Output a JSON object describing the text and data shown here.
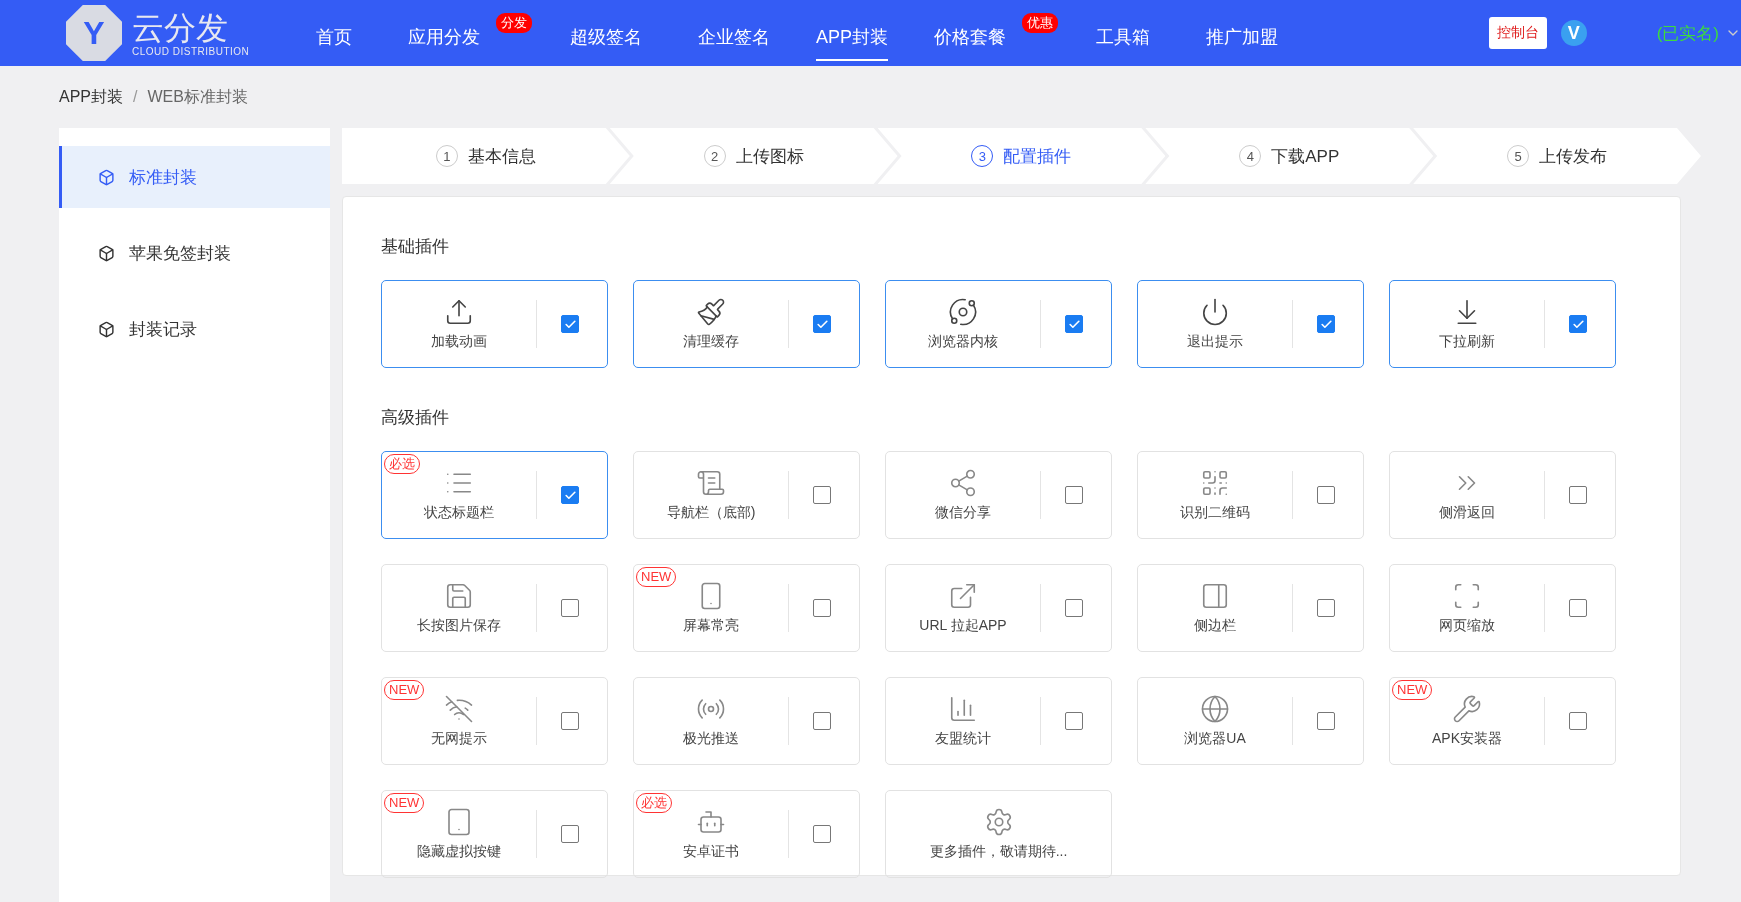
{
  "header": {
    "logo_letter": "Y",
    "logo_title": "云分发",
    "logo_subtitle": "CLOUD DISTRIBUTION",
    "nav": [
      {
        "label": "首页",
        "selected": false
      },
      {
        "label": "应用分发",
        "selected": false,
        "badge": "分发"
      },
      {
        "label": "超级签名",
        "selected": false
      },
      {
        "label": "企业签名",
        "selected": false
      },
      {
        "label": "APP封装",
        "selected": true
      },
      {
        "label": "价格套餐",
        "selected": false,
        "badge": "优惠"
      },
      {
        "label": "工具箱",
        "selected": false
      },
      {
        "label": "推广加盟",
        "selected": false
      }
    ],
    "console_button": "控制台",
    "vip_letter": "V",
    "user_status": "(已实名)"
  },
  "breadcrumb": {
    "items": [
      "APP封装",
      "WEB标准封装"
    ],
    "separator": "/"
  },
  "sidebar": {
    "items": [
      {
        "label": "标准封装",
        "selected": true
      },
      {
        "label": "苹果免签封装",
        "selected": false
      },
      {
        "label": "封装记录",
        "selected": false
      }
    ]
  },
  "steps": [
    {
      "number": "1",
      "label": "基本信息",
      "selected": false
    },
    {
      "number": "2",
      "label": "上传图标",
      "selected": false
    },
    {
      "number": "3",
      "label": "配置插件",
      "selected": true
    },
    {
      "number": "4",
      "label": "下载APP",
      "selected": false
    },
    {
      "number": "5",
      "label": "上传发布",
      "selected": false
    }
  ],
  "sections": [
    {
      "title": "基础插件",
      "plugins": [
        {
          "kind": "toggle",
          "label": "加载动画",
          "checked": true
        },
        {
          "kind": "toggle",
          "label": "清理缓存",
          "checked": true
        },
        {
          "kind": "toggle",
          "label": "浏览器内核",
          "checked": true
        },
        {
          "kind": "toggle",
          "label": "退出提示",
          "checked": true
        },
        {
          "kind": "toggle",
          "label": "下拉刷新",
          "checked": true
        }
      ]
    },
    {
      "title": "高级插件",
      "plugins": [
        {
          "kind": "toggle",
          "label": "状态标题栏",
          "checked": true,
          "badge": "必选"
        },
        {
          "kind": "toggle",
          "label": "导航栏（底部)",
          "checked": false
        },
        {
          "kind": "toggle",
          "label": "微信分享",
          "checked": false
        },
        {
          "kind": "toggle",
          "label": "识别二维码",
          "checked": false
        },
        {
          "kind": "toggle",
          "label": "侧滑返回",
          "checked": false
        },
        {
          "kind": "toggle",
          "label": "长按图片保存",
          "checked": false
        },
        {
          "kind": "toggle",
          "label": "屏幕常亮",
          "checked": false,
          "badge": "NEW"
        },
        {
          "kind": "toggle",
          "label": "URL 拉起APP",
          "checked": false
        },
        {
          "kind": "toggle",
          "label": "侧边栏",
          "checked": false
        },
        {
          "kind": "toggle",
          "label": "网页缩放",
          "checked": false
        },
        {
          "kind": "toggle",
          "label": "无网提示",
          "checked": false,
          "badge": "NEW"
        },
        {
          "kind": "toggle",
          "label": "极光推送",
          "checked": false
        },
        {
          "kind": "toggle",
          "label": "友盟统计",
          "checked": false
        },
        {
          "kind": "toggle",
          "label": "浏览器UA",
          "checked": false
        },
        {
          "kind": "toggle",
          "label": "APK安装器",
          "checked": false,
          "badge": "NEW"
        },
        {
          "kind": "toggle",
          "label": "隐藏虚拟按键",
          "checked": false,
          "badge": "NEW"
        },
        {
          "kind": "toggle",
          "label": "安卓证书",
          "checked": false,
          "badge": "必选"
        },
        {
          "kind": "more",
          "label": "更多插件，敬请期待..."
        }
      ]
    }
  ]
}
